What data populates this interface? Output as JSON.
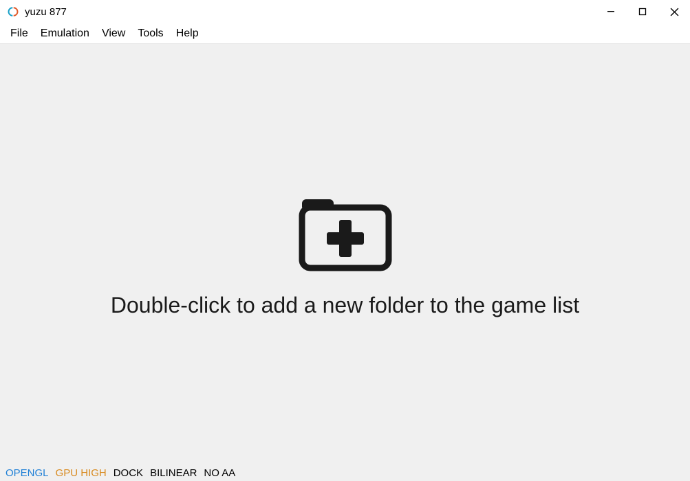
{
  "window": {
    "title": "yuzu 877"
  },
  "menubar": {
    "items": [
      "File",
      "Emulation",
      "View",
      "Tools",
      "Help"
    ]
  },
  "main": {
    "empty_message": "Double-click to add a new folder to the game list"
  },
  "statusbar": {
    "renderer": "OPENGL",
    "gpu": "GPU HIGH",
    "dock": "DOCK",
    "filter": "BILINEAR",
    "aa": "NO AA"
  }
}
